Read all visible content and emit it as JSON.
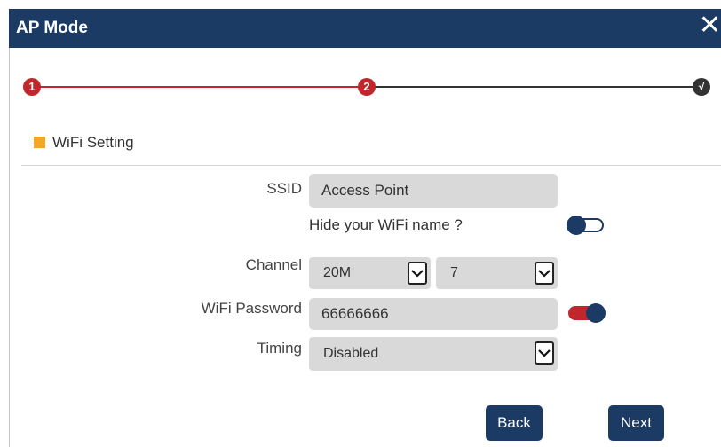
{
  "window": {
    "title": "AP Mode",
    "close_glyph": "✕"
  },
  "stepper": {
    "steps": [
      "1",
      "2",
      "√"
    ],
    "colors": {
      "active": "#c0272d",
      "inactive": "#333333"
    }
  },
  "section": {
    "title": "WiFi Setting",
    "marker_color": "#f5a623"
  },
  "form": {
    "ssid_label": "SSID",
    "ssid_value": "Access Point",
    "hide_label": "Hide your WiFi name ?",
    "hide_toggle_on": false,
    "channel_label": "Channel",
    "bandwidth_value": "20M",
    "channel_value": "7",
    "password_label": "WiFi Password",
    "password_value": "66666666",
    "password_toggle_on": true,
    "timing_label": "Timing",
    "timing_value": "Disabled"
  },
  "buttons": {
    "back": "Back",
    "next": "Next"
  },
  "colors": {
    "primary": "#1b3a64",
    "field_bg": "#d9d9d9",
    "accent_red": "#c0272d"
  }
}
